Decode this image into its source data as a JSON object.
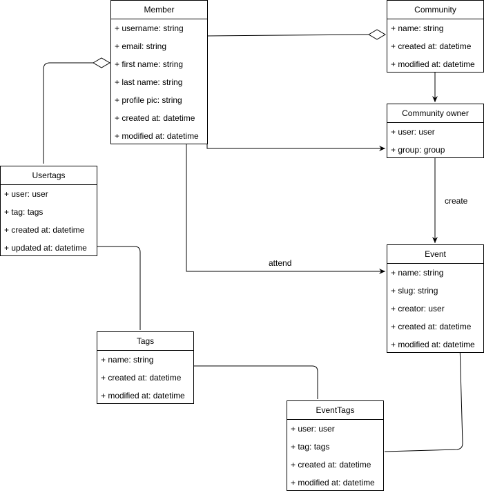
{
  "classes": {
    "member": {
      "title": "Member",
      "attrs": [
        "+ username: string",
        "+ email: string",
        "+ first name: string",
        "+ last name: string",
        "+ profile pic: string",
        "+ created at: datetime",
        "+ modified at: datetime"
      ]
    },
    "community": {
      "title": "Community",
      "attrs": [
        "+ name: string",
        "+ created at: datetime",
        "+ modified at: datetime"
      ]
    },
    "community_owner": {
      "title": "Community owner",
      "attrs": [
        "+ user: user",
        "+ group: group"
      ]
    },
    "usertags": {
      "title": "Usertags",
      "attrs": [
        "+ user: user",
        "+ tag: tags",
        "+ created at: datetime",
        "+ updated at: datetime"
      ]
    },
    "event": {
      "title": "Event",
      "attrs": [
        "+ name: string",
        "+ slug: string",
        "+ creator: user",
        "+ created at: datetime",
        "+ modified at: datetime"
      ]
    },
    "tags": {
      "title": "Tags",
      "attrs": [
        "+ name: string",
        "+ created at: datetime",
        "+ modified at: datetime"
      ]
    },
    "eventtags": {
      "title": "EventTags",
      "attrs": [
        "+ user: user",
        "+ tag: tags",
        "+ created at: datetime",
        "+ modified at: datetime"
      ]
    }
  },
  "edges": {
    "create_label": "create",
    "attend_label": "attend"
  }
}
